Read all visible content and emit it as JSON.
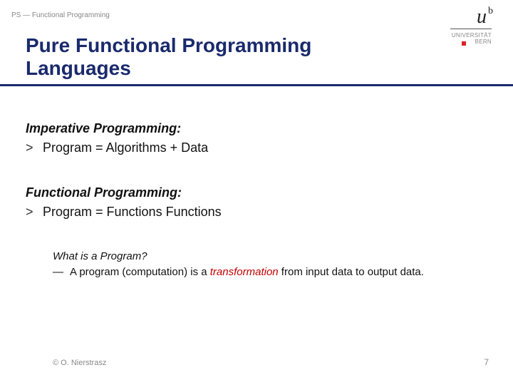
{
  "header": {
    "label": "PS — Functional Programming"
  },
  "logo": {
    "u": "u",
    "b": "b",
    "sub1": "UNIVERSITÄT",
    "sub2": "BERN"
  },
  "title": {
    "line1": "Pure Functional Programming",
    "line2": "Languages"
  },
  "section1": {
    "heading": "Imperative Programming:",
    "bullet_sym": ">",
    "bullet_text": "Program = Algorithms + Data"
  },
  "section2": {
    "heading": "Functional Programming:",
    "bullet_sym": ">",
    "bullet_text": "Program = Functions  Functions"
  },
  "question": {
    "heading": "What is a Program?",
    "dash": "—",
    "pre": "A program (computation) is a ",
    "emph": "transformation",
    "post": " from input data to output data."
  },
  "footer": {
    "left": "© O. Nierstrasz",
    "right": "7"
  }
}
